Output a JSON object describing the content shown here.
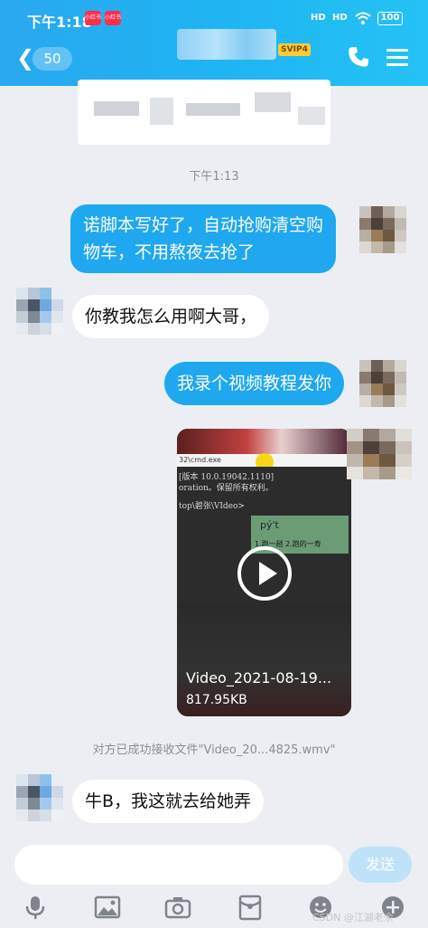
{
  "status_bar": {
    "time": "下午1:18",
    "signal_1": "HD",
    "signal_2": "HD",
    "battery": "100",
    "notif_1": "小红书",
    "notif_2": "小红书"
  },
  "header": {
    "back_count": "50",
    "vip_badge": "SVIP4"
  },
  "messages": {
    "timestamp": "下午1:13",
    "msg1": {
      "line1": "诺脚本写好了，自动抢购清空购",
      "line2": "物车，不用熬夜去抢了"
    },
    "msg2": "你教我怎么用啊大哥，",
    "msg3": "我录个视频教程发你",
    "video": {
      "titlebar": "32\\cmd.exe",
      "cmd_line1": "[版本 10.0.19042.1110]",
      "cmd_line2": "oration。保留所有权利。",
      "cmd_line3": "top\\碧张\\VIdeo>",
      "ime_text": "pý't",
      "ime_candidates": "1.跑一趟  2.跑的一寿",
      "name": "Video_2021-08-19...",
      "size": "817.95KB"
    },
    "system": "对方已成功接收文件\"Video_20...4825.wmv\"",
    "msg4": "牛B，我这就去给她弄"
  },
  "input": {
    "send_label": "发送"
  },
  "watermark": "CSDN @江湖老余"
}
